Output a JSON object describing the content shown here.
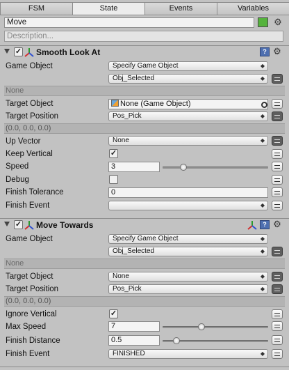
{
  "tabs": [
    "FSM",
    "State",
    "Events",
    "Variables"
  ],
  "state": {
    "name": "Move",
    "description_placeholder": "Description...",
    "color": "#55b33c"
  },
  "icons": {
    "settings": "gear-icon",
    "help": "help-icon",
    "transform": "transform-axes-icon"
  },
  "actions": [
    {
      "title": "Smooth Look At",
      "enabled": true,
      "game_object_label": "Game Object",
      "game_object_mode": "Specify Game Object",
      "game_object_var": "Obj_Selected",
      "none_text": "None",
      "target_object_label": "Target Object",
      "target_object_value": "None (Game Object)",
      "target_position_label": "Target Position",
      "target_position_value": "Pos_Pick",
      "vector_text": "(0.0, 0.0, 0.0)",
      "up_vector_label": "Up Vector",
      "up_vector_value": "None",
      "keep_vertical_label": "Keep Vertical",
      "keep_vertical_checked": true,
      "speed_label": "Speed",
      "speed_value": "3",
      "speed_slider_fraction": 0.2,
      "debug_label": "Debug",
      "debug_checked": false,
      "finish_tolerance_label": "Finish Tolerance",
      "finish_tolerance_value": "0",
      "finish_event_label": "Finish Event",
      "finish_event_value": ""
    },
    {
      "title": "Move Towards",
      "enabled": true,
      "game_object_label": "Game Object",
      "game_object_mode": "Specify Game Object",
      "game_object_var": "Obj_Selected",
      "none_text": "None",
      "target_object_label": "Target Object",
      "target_object_value": "None",
      "target_position_label": "Target Position",
      "target_position_value": "Pos_Pick",
      "vector_text": "(0.0, 0.0, 0.0)",
      "ignore_vertical_label": "Ignore Vertical",
      "ignore_vertical_checked": true,
      "max_speed_label": "Max Speed",
      "max_speed_value": "7",
      "max_speed_slider_fraction": 0.37,
      "finish_distance_label": "Finish Distance",
      "finish_distance_value": "0.5",
      "finish_distance_slider_fraction": 0.13,
      "finish_event_label": "Finish Event",
      "finish_event_value": "FINISHED"
    }
  ]
}
